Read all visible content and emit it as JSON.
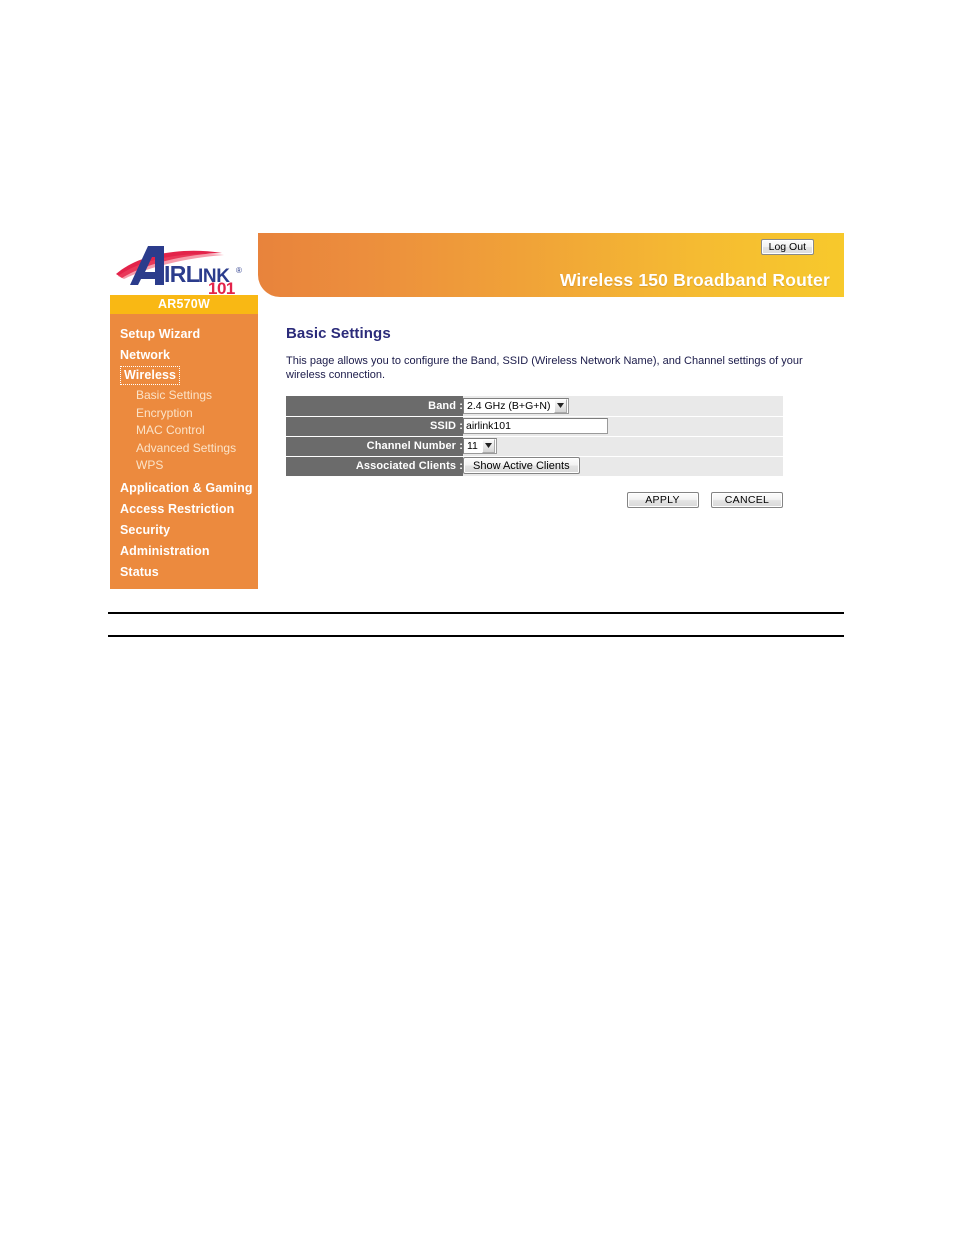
{
  "header": {
    "product_title": "Wireless 150 Broadband Router",
    "logout_label": "Log Out",
    "logo_text_main": "AIRLINK",
    "logo_text_sub": "101",
    "logo_registered_mark": "®",
    "brand_blue": "#2b3c8c",
    "brand_red": "#e3234a",
    "band_gradient_start": "#e8833c",
    "band_gradient_end": "#f7c92c"
  },
  "sidebar": {
    "model_label": "AR570W",
    "model_bar_color": "#f9b814",
    "background_color": "#ec8a3e",
    "items": [
      {
        "label": "Setup Wizard",
        "level": "top",
        "selected": false
      },
      {
        "label": "Network",
        "level": "top",
        "selected": false
      },
      {
        "label": "Wireless",
        "level": "top",
        "selected": true
      },
      {
        "label": "Basic Settings",
        "level": "sub",
        "selected": false
      },
      {
        "label": "Encryption",
        "level": "sub",
        "selected": false
      },
      {
        "label": "MAC Control",
        "level": "sub",
        "selected": false
      },
      {
        "label": "Advanced Settings",
        "level": "sub",
        "selected": false
      },
      {
        "label": "WPS",
        "level": "sub",
        "selected": false
      },
      {
        "label": "Application & Gaming",
        "level": "top",
        "selected": false
      },
      {
        "label": "Access Restriction",
        "level": "top",
        "selected": false
      },
      {
        "label": "Security",
        "level": "top",
        "selected": false
      },
      {
        "label": "Administration",
        "level": "top",
        "selected": false
      },
      {
        "label": "Status",
        "level": "top",
        "selected": false
      }
    ]
  },
  "content": {
    "title": "Basic Settings",
    "title_color": "#2b2b7a",
    "description": "This page allows you to configure the Band, SSID (Wireless Network Name), and Channel settings of your wireless connection.",
    "rows": {
      "band": {
        "label": "Band :",
        "control": "select",
        "value": "2.4 GHz (B+G+N)"
      },
      "ssid": {
        "label": "SSID :",
        "control": "text",
        "value": "airlink101",
        "placeholder": ""
      },
      "channel": {
        "label": "Channel Number :",
        "control": "select",
        "value": "11"
      },
      "clients": {
        "label": "Associated Clients :",
        "control": "button",
        "value": "Show Active Clients"
      }
    },
    "label_cell_color": "#6b6b6b",
    "value_cell_color": "#e9e9e9"
  },
  "actions": {
    "apply_label": "APPLY",
    "cancel_label": "CANCEL"
  }
}
